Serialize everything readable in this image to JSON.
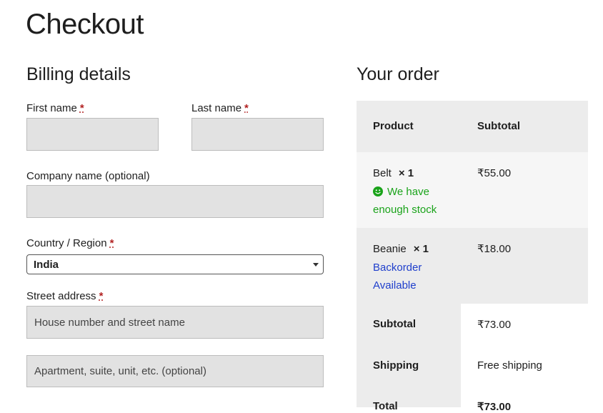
{
  "page": {
    "title": "Checkout"
  },
  "billing": {
    "title": "Billing details",
    "required_mark": "*",
    "first_name": {
      "label": "First name",
      "value": "",
      "placeholder": ""
    },
    "last_name": {
      "label": "Last name",
      "value": "",
      "placeholder": ""
    },
    "company": {
      "label": "Company name (optional)",
      "value": "",
      "placeholder": ""
    },
    "country": {
      "label": "Country / Region",
      "value": "India"
    },
    "street": {
      "label": "Street address",
      "line1_placeholder": "House number and street name",
      "line2_placeholder": "Apartment, suite, unit, etc. (optional)"
    }
  },
  "order": {
    "title": "Your order",
    "headers": {
      "product": "Product",
      "subtotal": "Subtotal"
    },
    "items": [
      {
        "name": "Belt",
        "qty": "× 1",
        "price": "₹55.00",
        "status_line1": "We have",
        "status_line2": "enough stock",
        "status_icon": "smiley-icon",
        "status_color": "#1aa31a"
      },
      {
        "name": "Beanie",
        "qty": "× 1",
        "price": "₹18.00",
        "status_line1": "Backorder",
        "status_line2": "Available",
        "status_color": "#1f3fcc"
      }
    ],
    "subtotal": {
      "label": "Subtotal",
      "value": "₹73.00"
    },
    "shipping": {
      "label": "Shipping",
      "value": "Free shipping"
    },
    "total": {
      "label": "Total",
      "value": "₹73.00"
    }
  },
  "colors": {
    "field_bg": "#e2e2e2",
    "table_header_bg": "#ececec",
    "table_row_bg": "#f6f6f6"
  }
}
